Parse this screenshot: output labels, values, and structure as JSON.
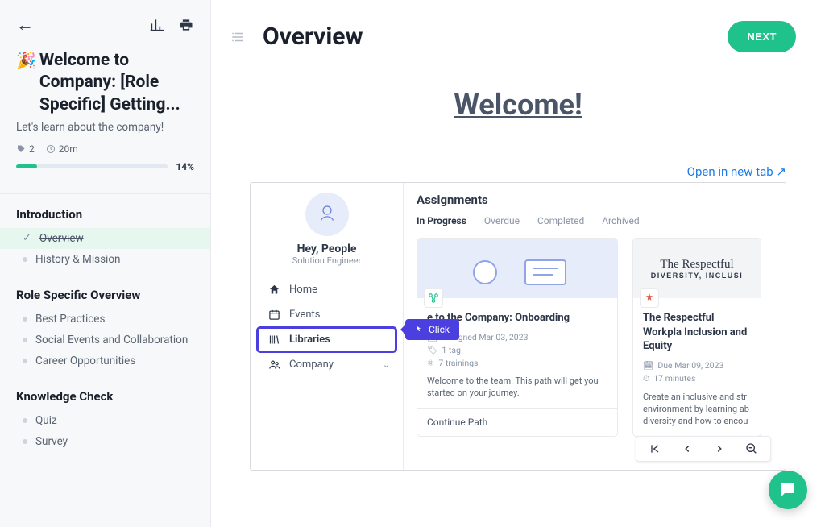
{
  "sidebar": {
    "course_emoji": "🎉",
    "course_title": "Welcome to Company: [Role Specific] Getting...",
    "course_subtitle": "Let's learn about the company!",
    "tags_count": "2",
    "duration": "20m",
    "progress_percent": "14%",
    "groups": [
      {
        "title": "Introduction",
        "items": [
          {
            "label": "Overview",
            "state": "current"
          },
          {
            "label": "History & Mission",
            "state": "default"
          }
        ]
      },
      {
        "title": "Role Specific Overview",
        "items": [
          {
            "label": "Best Practices",
            "state": "default"
          },
          {
            "label": "Social Events and Collaboration",
            "state": "default"
          },
          {
            "label": "Career Opportunities",
            "state": "default"
          }
        ]
      },
      {
        "title": "Knowledge Check",
        "items": [
          {
            "label": "Quiz",
            "state": "default"
          },
          {
            "label": "Survey",
            "state": "default"
          }
        ]
      }
    ]
  },
  "header": {
    "page_title": "Overview",
    "next_button": "NEXT"
  },
  "content": {
    "welcome_heading": "Welcome!",
    "open_in_new_tab": "Open in new tab ↗"
  },
  "embed": {
    "greeting": "Hey, People",
    "role": "Solution Engineer",
    "nav": [
      {
        "icon": "home",
        "label": "Home"
      },
      {
        "icon": "calendar",
        "label": "Events"
      },
      {
        "icon": "books",
        "label": "Libraries",
        "highlight": true
      },
      {
        "icon": "people",
        "label": "Company",
        "chevron": true
      }
    ],
    "click_tooltip": "Click",
    "assignments": {
      "title": "Assignments",
      "tabs": [
        "In Progress",
        "Overdue",
        "Completed",
        "Archived"
      ],
      "active_tab": "In Progress",
      "cards": [
        {
          "badge_color": "#1FC28B",
          "title_partial": "e to the Company: Onboarding",
          "assigned": "Assigned Mar 03, 2023",
          "tag": "1 tag",
          "trainings": "7 trainings",
          "desc": "Welcome to the team! This path will get you started on your journey.",
          "footer": "Continue Path"
        },
        {
          "badge_color": "#E25D4E",
          "overlay_big": "The Respectful",
          "overlay_small": "DIVERSITY, INCLUSI",
          "title": "The Respectful Workpla Inclusion and Equity",
          "due": "Due Mar 09, 2023",
          "minutes": "17 minutes",
          "desc": "Create an inclusive and str environment by learning ab diversity and how to encou"
        }
      ]
    }
  }
}
